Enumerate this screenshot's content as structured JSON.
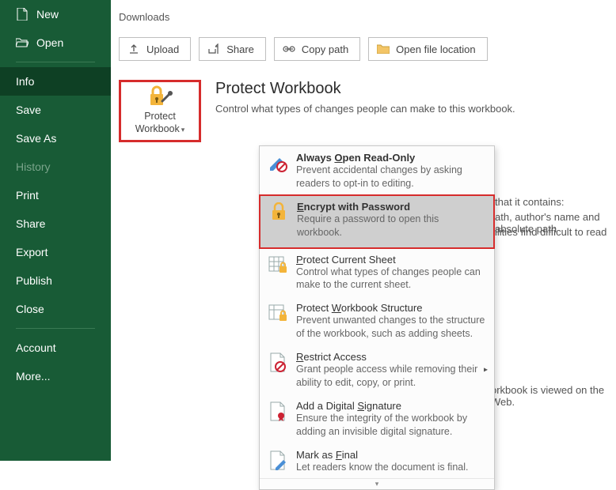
{
  "sidebar": {
    "new": "New",
    "open": "Open",
    "info": "Info",
    "save": "Save",
    "save_as": "Save As",
    "history": "History",
    "print": "Print",
    "share": "Share",
    "export": "Export",
    "publish": "Publish",
    "close": "Close",
    "account": "Account",
    "more": "More..."
  },
  "breadcrumb": "Downloads",
  "toolbar": {
    "upload": "Upload",
    "share": "Share",
    "copy_path": "Copy path",
    "open_location": "Open file location"
  },
  "protect": {
    "button_line1": "Protect",
    "button_line2": "Workbook",
    "title": "Protect Workbook",
    "desc": "Control what types of changes people can make to this workbook."
  },
  "menu": {
    "items": [
      {
        "title_pre": "Always ",
        "title_u": "O",
        "title_post": "pen Read-Only",
        "desc": "Prevent accidental changes by asking readers to opt-in to editing."
      },
      {
        "title_pre": "",
        "title_u": "E",
        "title_post": "ncrypt with Password",
        "desc": "Require a password to open this workbook."
      },
      {
        "title_pre": "",
        "title_u": "P",
        "title_post": "rotect Current Sheet",
        "desc": "Control what types of changes people can make to the current sheet."
      },
      {
        "title_pre": "Protect ",
        "title_u": "W",
        "title_post": "orkbook Structure",
        "desc": "Prevent unwanted changes to the structure of the workbook, such as adding sheets."
      },
      {
        "title_pre": "",
        "title_u": "R",
        "title_post": "estrict Access",
        "desc": "Grant people access while removing their ability to edit, copy, or print."
      },
      {
        "title_pre": "Add a Digital ",
        "title_u": "S",
        "title_post": "ignature",
        "desc": "Ensure the integrity of the workbook by adding an invisible digital signature."
      },
      {
        "title_pre": "Mark as ",
        "title_u": "F",
        "title_post": "inal",
        "desc": "Let readers know the document is final."
      }
    ]
  },
  "bgtext": {
    "l1": "that it contains:",
    "l2": "ath, author's name and absolute path",
    "l3": "ilities find difficult to read",
    "l4": "orkbook is viewed on the Web."
  }
}
